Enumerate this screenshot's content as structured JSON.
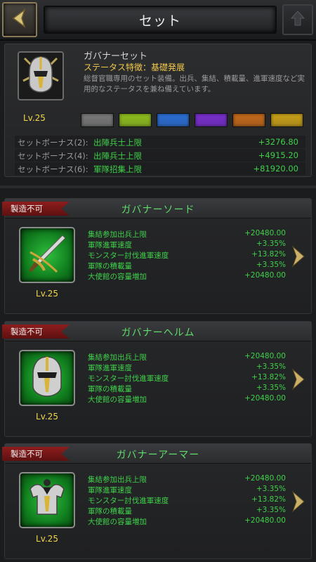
{
  "header": {
    "title": "セット",
    "back_icon": "back-arrow-icon",
    "help_icon": "info-icon"
  },
  "set": {
    "name": "ガバナーセット",
    "trait": "ステータス特徴：基礎発展",
    "description": "総督官職専用のセット装備。出兵、集結、積載量、進軍速度など実用的なステータスを兼ね備えています。",
    "level": "Lv.25",
    "icon": "governor-helmet-emblem-icon",
    "quality_colors": [
      "#7a7a7a",
      "#8fbf1e",
      "#2b6fd6",
      "#7a2ed0",
      "#c4691a",
      "#c9a118"
    ],
    "bonuses": [
      {
        "label": "セットボーナス(2):",
        "stat": "出陣兵士上限",
        "value": "+3276.80"
      },
      {
        "label": "セットボーナス(4):",
        "stat": "出陣兵士上限",
        "value": "+4915.20"
      },
      {
        "label": "セットボーナス(6):",
        "stat": "軍隊招集上限",
        "value": "+81920.00"
      }
    ]
  },
  "items": [
    {
      "status": "製造不可",
      "name": "ガバナーソード",
      "level": "Lv.25",
      "icon": "sword-icon",
      "stats": [
        {
          "label": "集結参加出兵上限",
          "value": "+20480.00"
        },
        {
          "label": "軍隊進軍速度",
          "value": "+3.35%"
        },
        {
          "label": "モンスター討伐進軍速度",
          "value": "+13.82%"
        },
        {
          "label": "軍隊の積載量",
          "value": "+3.35%"
        },
        {
          "label": "大使館の容量増加",
          "value": "+20480.00"
        }
      ]
    },
    {
      "status": "製造不可",
      "name": "ガバナーヘルム",
      "level": "Lv.25",
      "icon": "helmet-icon",
      "stats": [
        {
          "label": "集結参加出兵上限",
          "value": "+20480.00"
        },
        {
          "label": "軍隊進軍速度",
          "value": "+3.35%"
        },
        {
          "label": "モンスター討伐進軍速度",
          "value": "+13.82%"
        },
        {
          "label": "軍隊の積載量",
          "value": "+3.35%"
        },
        {
          "label": "大使館の容量増加",
          "value": "+20480.00"
        }
      ]
    },
    {
      "status": "製造不可",
      "name": "ガバナーアーマー",
      "level": "Lv.25",
      "icon": "armor-icon",
      "stats": [
        {
          "label": "集結参加出兵上限",
          "value": "+20480.00"
        },
        {
          "label": "軍隊進軍速度",
          "value": "+3.35%"
        },
        {
          "label": "モンスター討伐進軍速度",
          "value": "+13.82%"
        },
        {
          "label": "軍隊の積載量",
          "value": "+3.35%"
        },
        {
          "label": "大使館の容量増加",
          "value": "+20480.00"
        }
      ]
    }
  ]
}
